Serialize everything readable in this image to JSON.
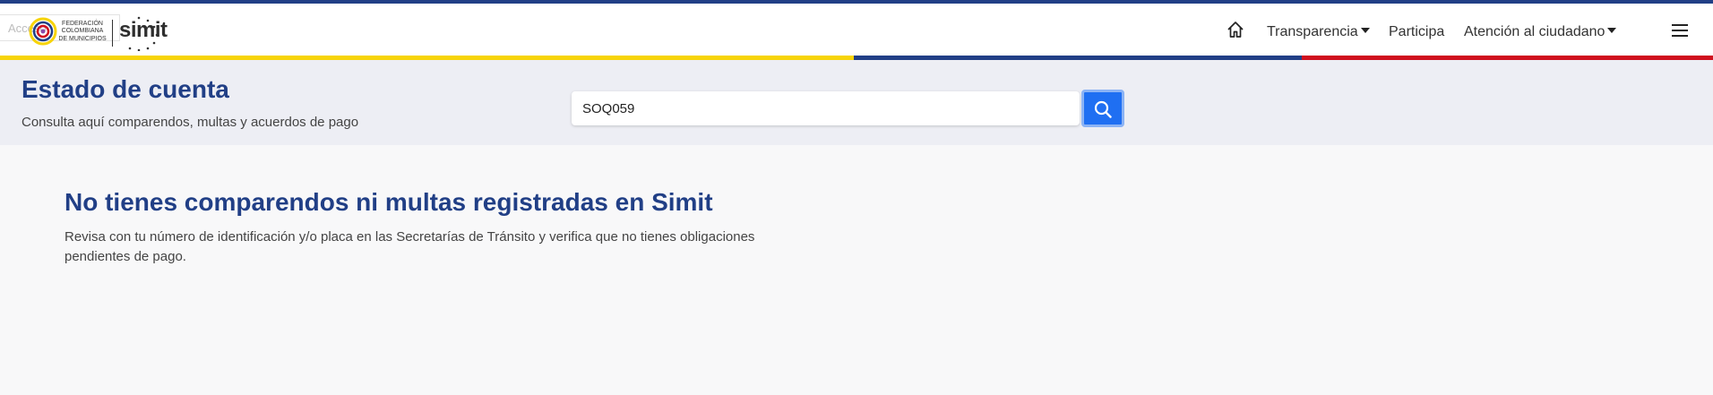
{
  "navbar": {
    "access_label": "Acceso",
    "logo": {
      "federacion_lines": [
        "FEDERACIÓN",
        "COLOMBIANA",
        "DE MUNICIPIOS"
      ],
      "simit": "simit"
    },
    "items": [
      {
        "label": "Transparencia",
        "dropdown": true
      },
      {
        "label": "Participa",
        "dropdown": false
      },
      {
        "label": "Atención al ciudadano",
        "dropdown": true
      }
    ],
    "home_icon": "home-icon",
    "menu_icon": "hamburger-menu-icon"
  },
  "colors": {
    "navy": "#213f86",
    "yellow": "#f7d40a",
    "red": "#d0101e",
    "search_button": "#1f6ff2",
    "banner_bg": "#edeef4"
  },
  "banner": {
    "title": "Estado de cuenta",
    "subtitle": "Consulta aquí comparendos, multas y acuerdos de pago"
  },
  "search": {
    "value": "SOQ059",
    "button_icon": "search-icon"
  },
  "result": {
    "title": "No tienes comparendos ni multas registradas en Simit",
    "description": "Revisa con tu número de identificación y/o placa en las Secretarías de Tránsito y verifica que no tienes obligaciones pendientes de pago."
  }
}
